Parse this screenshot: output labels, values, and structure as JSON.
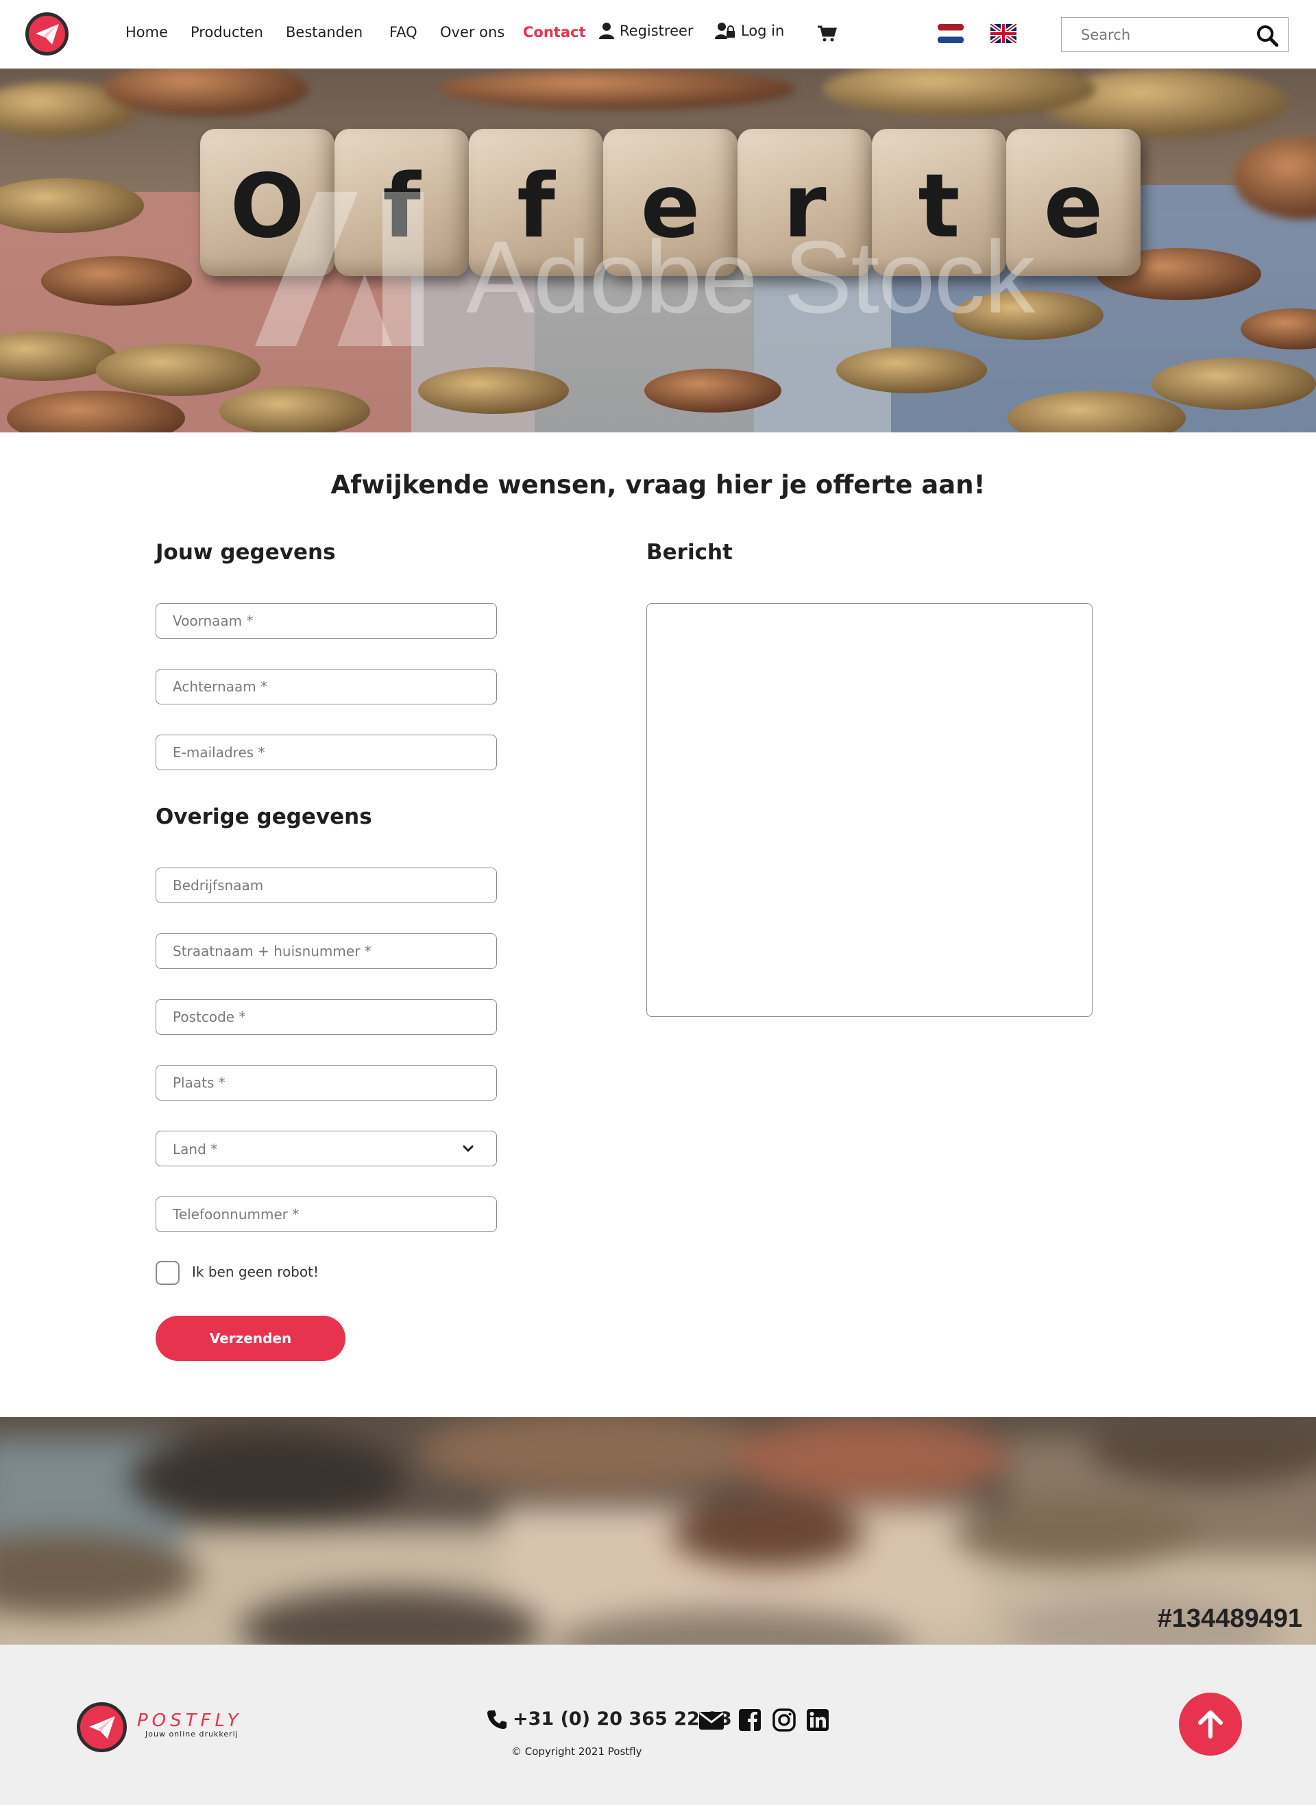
{
  "header": {
    "nav": [
      "Home",
      "Producten",
      "Bestanden",
      "FAQ",
      "Over ons",
      "Contact"
    ],
    "register": "Registreer",
    "login": "Log in",
    "search_placeholder": "Search"
  },
  "hero": {
    "cube_letters": [
      "O",
      "f",
      "f",
      "e",
      "r",
      "t",
      "e"
    ],
    "watermark": "Adobe Stock"
  },
  "main": {
    "heading": "Afwijkende wensen, vraag hier je offerte aan!",
    "section_personal": "Jouw gegevens",
    "section_other": "Overige gegevens",
    "section_message": "Bericht",
    "placeholders": {
      "first_name": "Voornaam *",
      "last_name": "Achternaam *",
      "email": "E-mailadres *",
      "company": "Bedrijfsnaam",
      "street": "Straatnaam + huisnummer *",
      "postcode": "Postcode *",
      "city": "Plaats *",
      "country": "Land *",
      "phone": "Telefoonnummer *"
    },
    "robot_label": "Ik ben geen robot!",
    "submit": "Verzenden"
  },
  "banner": {
    "stock_id": "#134489491"
  },
  "footer": {
    "brand": "POSTFLY",
    "tagline": "Jouw online drukkerij",
    "phone": "+31 (0) 20 365 22 93",
    "copyright": "© Copyright 2021 Postfly"
  },
  "colors": {
    "accent": "#e8334e",
    "text": "#1f1f1f",
    "footer_bg": "#efefef"
  }
}
